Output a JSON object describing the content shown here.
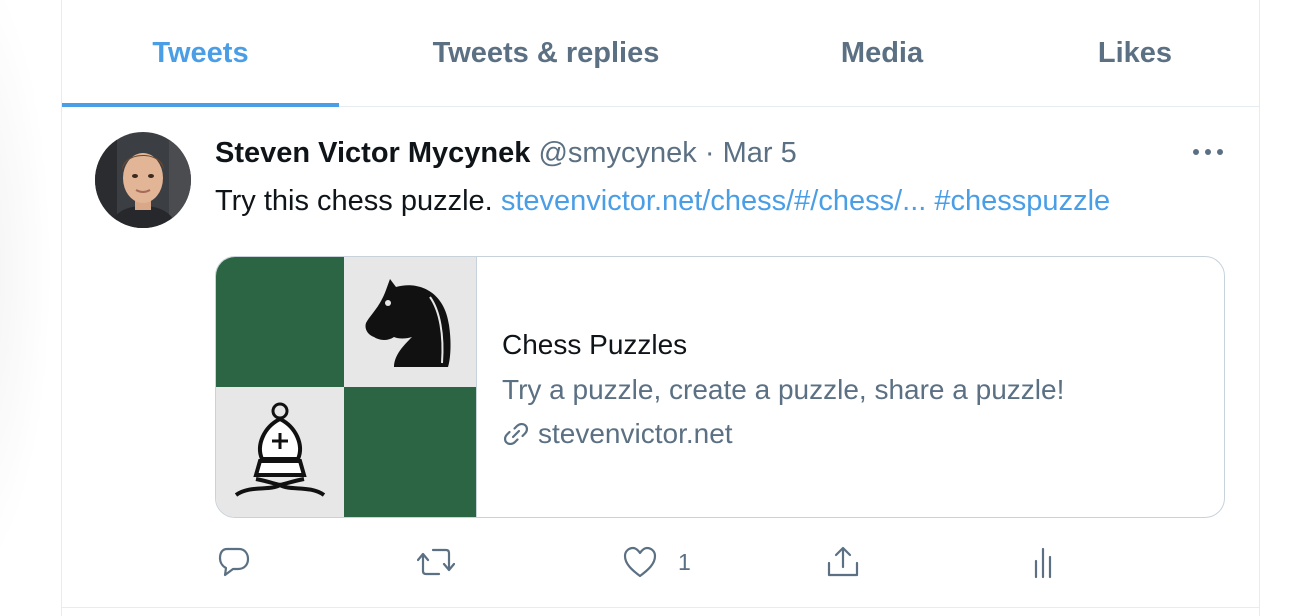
{
  "tabs": [
    {
      "label": "Tweets",
      "active": true
    },
    {
      "label": "Tweets & replies",
      "active": false
    },
    {
      "label": "Media",
      "active": false
    },
    {
      "label": "Likes",
      "active": false
    }
  ],
  "tweet": {
    "author_name": "Steven Victor Mycynek",
    "author_handle": "@smycynek",
    "separator": "·",
    "date": "Mar 5",
    "text": "Try this chess puzzle.",
    "link_text": "stevenvictor.net/chess/#/chess/...",
    "hashtag": "#chesspuzzle",
    "card": {
      "title": "Chess Puzzles",
      "description": "Try a puzzle, create a puzzle, share a puzzle!",
      "domain": "stevenvictor.net"
    },
    "actions": {
      "reply_icon": "reply-icon",
      "retweet_icon": "retweet-icon",
      "like_icon": "heart-icon",
      "like_count": "1",
      "share_icon": "share-icon",
      "analytics_icon": "analytics-icon"
    }
  },
  "colors": {
    "accent": "#4a9ee6",
    "secondary_text": "#5b7083",
    "board_dark": "#2b6543",
    "board_light": "#e7e7e7"
  }
}
